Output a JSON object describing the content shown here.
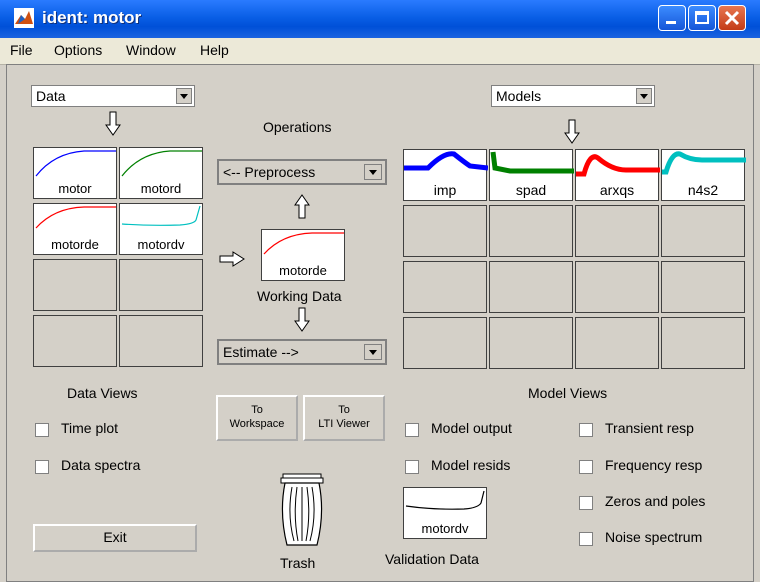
{
  "window": {
    "title": "ident: motor"
  },
  "menubar": {
    "items": [
      "File",
      "Options",
      "Window",
      "Help"
    ]
  },
  "data_panel": {
    "select_value": "Data",
    "tiles": [
      "motor",
      "motord",
      "motorde",
      "motordv"
    ],
    "views_title": "Data Views",
    "checkboxes": [
      "Time plot",
      "Data spectra"
    ],
    "exit_label": "Exit"
  },
  "operations": {
    "title": "Operations",
    "preprocess_value": "<-- Preprocess",
    "working_data_tile": "motorde",
    "working_data_label": "Working Data",
    "estimate_value": "Estimate -->",
    "to_workspace": [
      "To",
      "Workspace"
    ],
    "to_lti": [
      "To",
      "LTI Viewer"
    ],
    "trash_label": "Trash",
    "validation_tile": "motordv",
    "validation_label": "Validation Data"
  },
  "models_panel": {
    "select_value": "Models",
    "tiles": [
      "imp",
      "spad",
      "arxqs",
      "n4s2"
    ],
    "views_title": "Model Views",
    "checkboxes_left": [
      "Model output",
      "Model resids"
    ],
    "checkboxes_right": [
      "Transient resp",
      "Frequency resp",
      "Zeros and poles",
      "Noise spectrum"
    ]
  },
  "colors": {
    "blue": "#0000ff",
    "green": "#008000",
    "red": "#ff0000",
    "cyan": "#00c0c0"
  }
}
